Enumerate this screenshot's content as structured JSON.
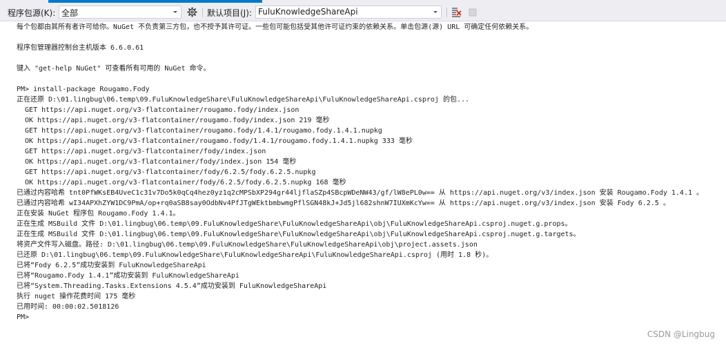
{
  "toolbar": {
    "source_label": "程序包源(K):",
    "source_value": "全部",
    "settings_icon": "gear-icon",
    "project_label": "默认项目(J):",
    "project_value": "FuluKnowledgeShareApi",
    "clear_icon": "clear-console-icon",
    "stop_icon": "stop-icon"
  },
  "console": {
    "lines": [
      "每个包都由其所有者许可给你。NuGet 不负责第三方包，也不授予其许可证。一些包可能包括受其他许可证约束的依赖关系。单击包源(源) URL 可确定任何依赖关系。",
      "",
      "程序包管理器控制台主机版本 6.6.0.61",
      "",
      "键入 \"get-help NuGet\" 可查看所有可用的 NuGet 命令。",
      "",
      "PM> install-package Rougamo.Fody",
      "正在还原 D:\\01.lingbug\\06.temp\\09.FuluKnowledgeShare\\FuluKnowledgeShareApi\\FuluKnowledgeShareApi.csproj 的包...",
      "  GET https://api.nuget.org/v3-flatcontainer/rougamo.fody/index.json",
      "  OK https://api.nuget.org/v3-flatcontainer/rougamo.fody/index.json 219 毫秒",
      "  GET https://api.nuget.org/v3-flatcontainer/rougamo.fody/1.4.1/rougamo.fody.1.4.1.nupkg",
      "  OK https://api.nuget.org/v3-flatcontainer/rougamo.fody/1.4.1/rougamo.fody.1.4.1.nupkg 333 毫秒",
      "  GET https://api.nuget.org/v3-flatcontainer/fody/index.json",
      "  OK https://api.nuget.org/v3-flatcontainer/fody/index.json 154 毫秒",
      "  GET https://api.nuget.org/v3-flatcontainer/fody/6.2.5/fody.6.2.5.nupkg",
      "  OK https://api.nuget.org/v3-flatcontainer/fody/6.2.5/fody.6.2.5.nupkg 168 毫秒",
      "已通过内容哈希 tnt0PfWKsEB4UveC1c31v7Do5k0qCq4hez0yz1q2cMPSbXP294gr44ljflaSZp4SBcpWDeNW43/gf/lW8ePL0w== 从 https://api.nuget.org/v3/index.json 安装 Rougamo.Fody 1.4.1 。",
      "已通过内容哈希 wI34APXhZYW1DC9PmA/op+rq0aSB8say0OdbNv4PfJTgWEktbmbwmgPflSGN48kJ+Jd5jl682shnW7IUXmKcYw== 从 https://api.nuget.org/v3/index.json 安装 Fody 6.2.5 。",
      "正在安装 NuGet 程序包 Rougamo.Fody 1.4.1。",
      "正在生成 MSBuild 文件 D:\\01.lingbug\\06.temp\\09.FuluKnowledgeShare\\FuluKnowledgeShareApi\\obj\\FuluKnowledgeShareApi.csproj.nuget.g.props。",
      "正在生成 MSBuild 文件 D:\\01.lingbug\\06.temp\\09.FuluKnowledgeShare\\FuluKnowledgeShareApi\\obj\\FuluKnowledgeShareApi.csproj.nuget.g.targets。",
      "将资产文件写入磁盘。路径: D:\\01.lingbug\\06.temp\\09.FuluKnowledgeShare\\FuluKnowledgeShareApi\\obj\\project.assets.json",
      "已还原 D:\\01.lingbug\\06.temp\\09.FuluKnowledgeShare\\FuluKnowledgeShareApi\\FuluKnowledgeShareApi.csproj (用时 1.8 秒)。",
      "已将“Fody 6.2.5”成功安装到 FuluKnowledgeShareApi",
      "已将“Rougamo.Fody 1.4.1”成功安装到 FuluKnowledgeShareApi",
      "已将“System.Threading.Tasks.Extensions 4.5.4”成功安装到 FuluKnowledgeShareApi",
      "执行 nuget 操作花费时间 175 毫秒",
      "已用时间: 00:00:02.5018126",
      "PM>"
    ]
  },
  "watermark": "CSDN @Lingbug",
  "colors": {
    "accent": "#007acc",
    "toolbar_bg": "#eeeef2",
    "text": "#1e1e1e",
    "clear_icon_red": "#e51400"
  }
}
